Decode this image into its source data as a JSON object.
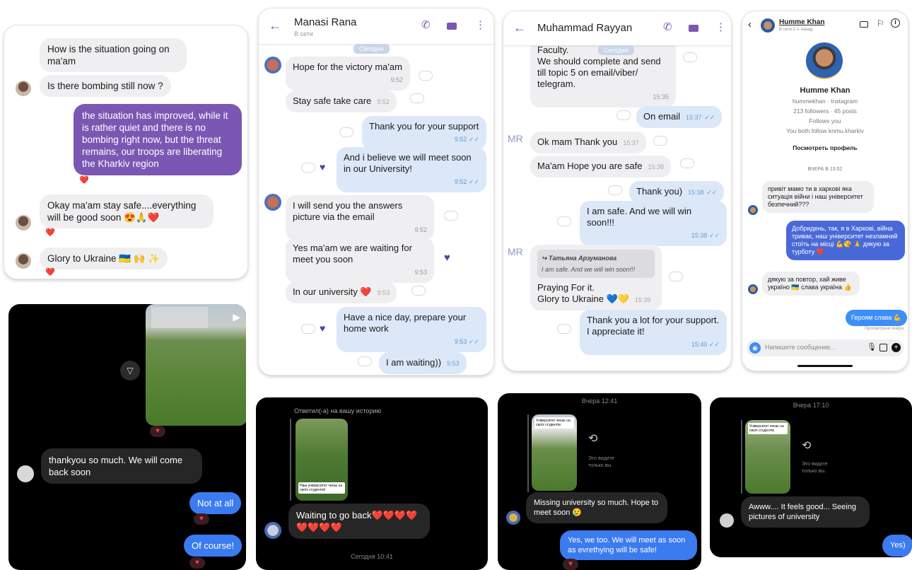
{
  "colors": {
    "viber_purple": "#7b57b3",
    "viber_bubble_blue": "#dce8f8",
    "insta_blue": "#3b7bf0",
    "heart": "#e03040"
  },
  "p1": {
    "m1": "How is the situation going on ma'am",
    "m2": "Is there bombing still now ?",
    "m3": "the situation has improved, while it is rather quiet and there is no bombing right now, but the threat remains, our troops are liberating the Kharkiv region",
    "m4": "Okay ma'am stay safe....everything will be good soon 😍🙏❤️",
    "m5": "Glory to Ukraine 🇺🇦 🙌 ✨",
    "reaction": "❤️"
  },
  "p2": {
    "name": "Manasi Rana",
    "status": "В сети",
    "date": "Сегодня",
    "m1": "Hope for the victory ma'am",
    "t1": "9:52",
    "m2": "Stay safe take care",
    "t2": "9:52",
    "m3": "Thank you for your support",
    "t3": "9:52",
    "m4": "And i believe we will meet soon in our University!",
    "t4": "9:52",
    "m5": "I will send you the answers picture via the email",
    "t5": "9:52",
    "m6": "Yes ma'am we are waiting for meet you soon",
    "t6": "9:53",
    "m7": "In our university ❤️",
    "t7": "9:53",
    "m8": "Have a nice day, prepare your home work",
    "t8": "9:53",
    "m9": "I am waiting))",
    "t9": "9:53"
  },
  "p3": {
    "name": "Muhammad Rayyan",
    "date": "Сегодня",
    "m0": "Faculty.\nWe should complete and send till topic 5 on email/viber/ telegram.",
    "t0": "15:35",
    "m1": "On email",
    "t1": "15:37",
    "avatar": "MR",
    "m2": "Ok mam Thank you",
    "t2": "15:37",
    "m3": "Ma'am Hope you are safe",
    "t3": "15:38",
    "m4": "Thank you)",
    "t4": "15:38",
    "m5": "I am safe. And we will win soon!!!",
    "t5": "15:38",
    "quote_name": "Татьяна Арзуманова",
    "quote_text": "I am safe. And we will win soon!!!",
    "m6": "Praying For it.\nGlory to Ukraine 💙💛",
    "t6": "15:39",
    "m7": "Thank you a lot for your support. I appreciate it!",
    "t7": "15:40"
  },
  "p4": {
    "name": "Humme Khan",
    "status": "В сети 2 ч. назад",
    "profile_name": "Humme Khan",
    "profile_sub": "hummekhan · Instagram",
    "profile_stats": "213 followers · 45 posts",
    "profile_follow": "Follows you",
    "profile_mutual": "You both follow knmu.kharkiv",
    "profile_button": "Посмотреть профиль",
    "date": "ВЧЕРА В 13:52",
    "m1": "привіт мамо ти в харкові яка ситуація війни і наш університет безпечний???",
    "m2": "Добридень, так, я в Харкові, війна триває, наш університет незламний стоїть на місці 💪😘 🙏 дякую за турботу ❤️",
    "m3": "дякую за повтор, хай живе україно 🇺🇦 слава україна 👍",
    "m4": "Героям слава 💪",
    "seen": "Просмотрено вчера",
    "input_placeholder": "Напишите сообщение..."
  },
  "p5": {
    "m1": "thankyou so much. We will come back soon",
    "m2": "Not at all",
    "m3": "Of course!"
  },
  "p6": {
    "replied": "Ответил(-а) на вашу историю",
    "story_caption": "Наш університет чекає на своїх студентів!",
    "m1": "Waiting to go back❤️❤️❤️❤️❤️❤️❤️❤️",
    "date": "Сегодня 10:41"
  },
  "p7": {
    "date": "Вчера 12:41",
    "story_caption": "Університет чекає на своїх студентів",
    "only_you": "Это видите только вы.",
    "m1": "Missing university so much. Hope to meet soon 😢",
    "m2": "Yes, we too. We will meet as soon as evrethying will be safe!"
  },
  "p8": {
    "date": "Вчера 17:10",
    "story_caption": "Університет чекає на своїх студентів",
    "only_you": "Это видите только вы.",
    "m1": "Awww.... It feels good... Seeing pictures of university",
    "m2": "Yes)"
  }
}
